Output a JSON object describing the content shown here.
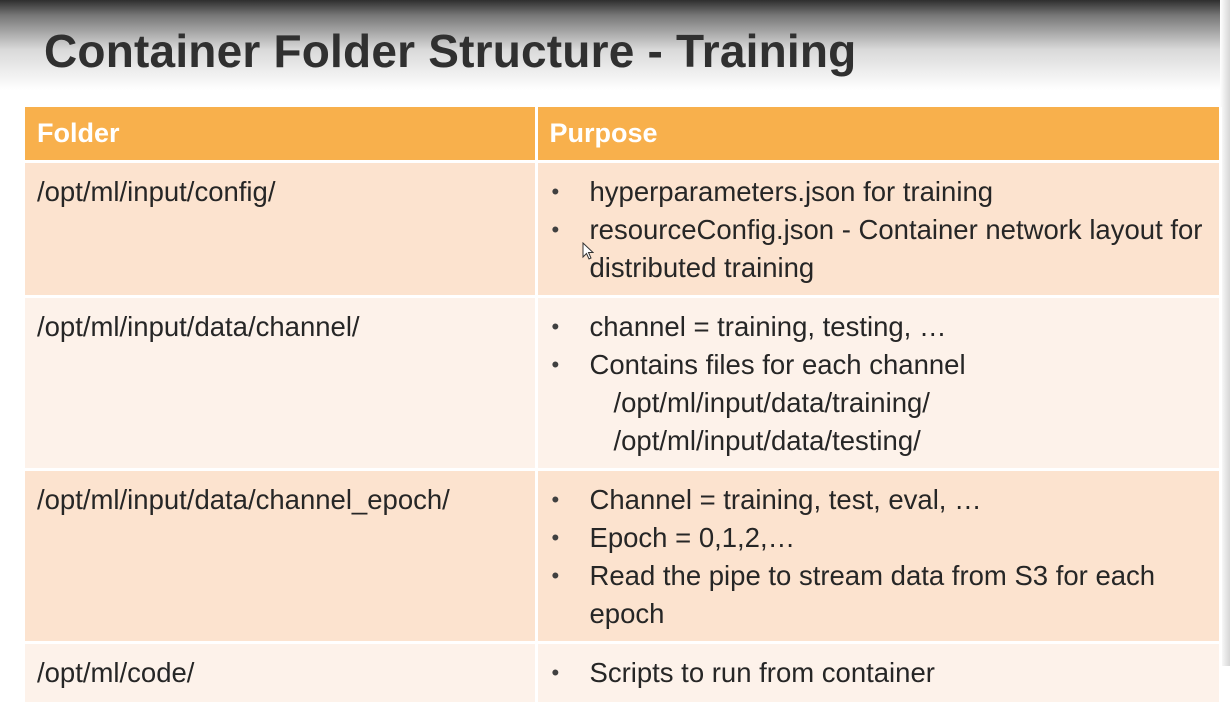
{
  "slide": {
    "title": "Container Folder Structure - Training"
  },
  "table": {
    "headers": [
      "Folder",
      "Purpose"
    ],
    "rows": [
      {
        "folder": "/opt/ml/input/config/",
        "purpose": [
          {
            "text": "hyperparameters.json for training"
          },
          {
            "text": "resourceConfig.json  - Container network layout for distributed training"
          }
        ]
      },
      {
        "folder": "/opt/ml/input/data/channel/",
        "purpose": [
          {
            "text": "channel = training, testing, …"
          },
          {
            "text": "Contains files for each channel",
            "sub": [
              "/opt/ml/input/data/training/",
              "/opt/ml/input/data/testing/"
            ]
          }
        ]
      },
      {
        "folder": "/opt/ml/input/data/channel_epoch/",
        "purpose": [
          {
            "text": "Channel = training, test, eval, …"
          },
          {
            "text": "Epoch = 0,1,2,…"
          },
          {
            "text": "Read the pipe to stream data from S3 for each epoch"
          }
        ]
      },
      {
        "folder": "/opt/ml/code/",
        "purpose": [
          {
            "text": "Scripts to run from container"
          }
        ]
      }
    ]
  },
  "colors": {
    "header_bg": "#f8b04c",
    "row_odd_bg": "#fce3cf",
    "row_even_bg": "#fdf2ea",
    "title_text": "#303030"
  },
  "icons": {
    "bullet": "bullet-icon",
    "pointer": "mouse-cursor-icon"
  }
}
